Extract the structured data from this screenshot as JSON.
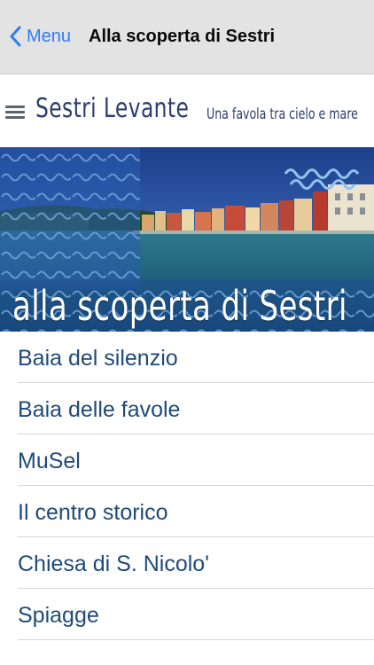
{
  "navbar": {
    "back_label": "Menu",
    "title": "Alla scoperta di Sestri"
  },
  "brand": {
    "name": "Sestri Levante",
    "tagline": "Una favola tra cielo e mare"
  },
  "banner": {
    "title": "alla scoperta di Sestri"
  },
  "menu": {
    "items": [
      {
        "label": "Baia del silenzio"
      },
      {
        "label": "Baia delle favole"
      },
      {
        "label": "MuSel"
      },
      {
        "label": "Il centro storico"
      },
      {
        "label": "Chiesa di S. Nicolo'"
      },
      {
        "label": "Spiagge"
      }
    ]
  },
  "colors": {
    "nav_background": "#e3e3e3",
    "accent": "#2f7cf6",
    "brand_text": "#2c3e70",
    "list_text": "#1f4a7a"
  }
}
